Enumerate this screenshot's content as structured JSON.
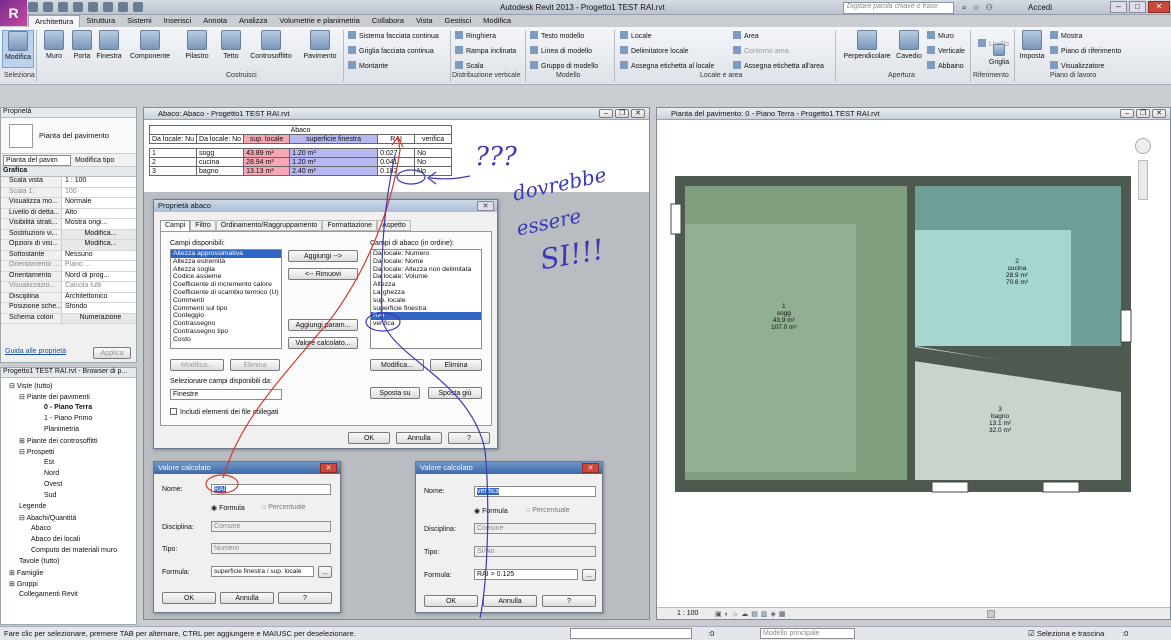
{
  "window": {
    "title": "Autodesk Revit 2013 -   Progetto1 TEST RAI.rvt",
    "search_placeholder": "Digitare parola chiave o frase",
    "signin": "Accedi"
  },
  "tabs": [
    "Architettura",
    "Struttura",
    "Sistemi",
    "Inserisci",
    "Annota",
    "Analizza",
    "Volumetrie e planimetria",
    "Collabora",
    "Vista",
    "Gestisci",
    "Modifica"
  ],
  "ribbon": {
    "big": [
      "Modifica",
      "Muro",
      "Porta",
      "Finestra",
      "Componente",
      "Pilastro",
      "Tetto",
      "Controsoffitto",
      "Pavimento",
      "Perpendicolare",
      "Cavedio",
      "Griglia",
      "Imposta"
    ],
    "small": [
      "Sistema facciata continua",
      "Griglia facciata continua",
      "Montante",
      "Ringhiera",
      "Rampa inclinata",
      "Scala",
      "Testo modello",
      "Linea di modello",
      "Gruppo di modello",
      "Locale",
      "Delimitatore  locale",
      "Assegna etichetta  al locale",
      "Area",
      "Contorno  area",
      "Assegna etichetta  all'area",
      "Muro",
      "Verticale",
      "Abbaino",
      "Livello",
      "Mostra",
      "Piano di riferimento",
      "Visualizzatore"
    ],
    "groups": [
      "Seleziona",
      "Costruisci",
      "Distribuzione verticale",
      "Modello",
      "Locale e area",
      "Apertura",
      "Riferimento",
      "Piano di lavoro"
    ]
  },
  "properties": {
    "title": "Proprietà",
    "type": "Pianta del pavimento",
    "selector": "Pianta del pavim",
    "edit_type": "Modifica tipo",
    "section": "Grafica",
    "rows": [
      [
        "Scala vista",
        "1 : 100"
      ],
      [
        "Scala 1:",
        "100"
      ],
      [
        "Visualizza mo...",
        "Normale"
      ],
      [
        "Livello di detta...",
        "Alto"
      ],
      [
        "Visibilità strati...",
        "Mostra origi..."
      ],
      [
        "Sostituzioni vi...",
        "Modifica..."
      ],
      [
        "Opzioni di visi...",
        "Modifica..."
      ],
      [
        "Sottostante",
        "Nessuno"
      ],
      [
        "Orientamento ...",
        "Piano ..."
      ],
      [
        "Orientamento",
        "Nord di prog..."
      ],
      [
        "Visualizzazio...",
        "Calcola tutti"
      ],
      [
        "Disciplina",
        "Architettonico"
      ],
      [
        "Posizione sche...",
        "Sfondo"
      ],
      [
        "Schema colori",
        "Numerazione"
      ]
    ],
    "help": "Guida alle proprietà",
    "apply": "Applica"
  },
  "browser": {
    "title": "Progetto1 TEST RAI.rvt - Browser di p...",
    "items": [
      "Viste (tutto)",
      "Piante dei pavimenti",
      "0 - Piano Terra",
      "1 - Piano Primo",
      "Planimetria",
      "Piante dei controsoffitti",
      "Prospetti",
      "Est",
      "Nord",
      "Ovest",
      "Sud",
      "Legende",
      "Abachi/Quantità",
      "Abaco",
      "Abaco dei locali",
      "Computo dei materiali muro",
      "Tavole (tutto)",
      "Famiglie",
      "Gruppi",
      "Collegamenti Revit"
    ]
  },
  "schedule": {
    "window_title": "Abaco: Abaco - Progetto1 TEST RAI.rvt",
    "caption": "Abaco",
    "headers": [
      "Da locale: Nu",
      "Da locale: No",
      "sup. locale",
      "superficie finestra",
      "RAI",
      "verifica"
    ],
    "rows": [
      [
        "1",
        "sogg",
        "43.89 m²",
        "1.20 m²",
        "0.027",
        "No"
      ],
      [
        "2",
        "cucina",
        "28.94 m²",
        "1.20 m²",
        "0.041",
        "No"
      ],
      [
        "3",
        "bagno",
        "13.13 m²",
        "2.40 m²",
        "0.183",
        "No"
      ]
    ]
  },
  "props_dialog": {
    "title": "Proprietà abaco",
    "tabs": [
      "Campi",
      "Filtro",
      "Ordinamento/Raggruppamento",
      "Formattazione",
      "Aspetto"
    ],
    "avail_label": "Campi disponibili:",
    "avail": [
      "Altezza approssimativa",
      "Altezza estremità",
      "Altezza soglia",
      "Codice assieme",
      "Coefficiente di incremento calore",
      "Coefficiente di scambio termico (U)",
      "Commenti",
      "Commenti sul tipo",
      "Conteggio",
      "Contrassegno",
      "Contrassegno tipo",
      "Costo"
    ],
    "sched_label": "Campi di abaco (in ordine):",
    "sched": [
      "Da locale: Numero",
      "Da locale: Nome",
      "Da locale: Altezza non delimitata",
      "Da locale: Volume",
      "Altezza",
      "Larghezza",
      "sup. locale",
      "superficie finestra",
      "RAI",
      "verifica"
    ],
    "add": "Aggiungi -->",
    "remove": "<-- Rimuovi",
    "add_param": "Aggiungi param...",
    "calc": "Valore calcolato...",
    "modify_l": "Modifica...",
    "delete_l": "Elimina",
    "modify_r": "Modifica...",
    "delete_r": "Elimina",
    "select_from": "Selezionare campi disponibili da:",
    "source": "Finestre",
    "include_links": "Includi elementi dei file collegati",
    "move_up": "Sposta su",
    "move_down": "Sposta giù",
    "ok": "OK",
    "cancel": "Annulla",
    "help": "?"
  },
  "calc1": {
    "title": "Valore calcolato",
    "name_label": "Nome:",
    "name": "RAI",
    "formula_opt": "Formula",
    "percent_opt": "Percentuale",
    "discipline_label": "Disciplina:",
    "discipline": "Comune",
    "type_label": "Tipo:",
    "type": "Numero",
    "formula_label": "Formula:",
    "formula": "superficie finestra / sup. locale",
    "browse": "...",
    "ok": "OK",
    "cancel": "Annulla",
    "help": "?"
  },
  "calc2": {
    "title": "Valore calcolato",
    "name_label": "Nome:",
    "name": "verifica",
    "formula_opt": "Formula",
    "percent_opt": "Percentuale",
    "discipline_label": "Disciplina:",
    "discipline": "Comune",
    "type_label": "Tipo:",
    "type": "Sì/No",
    "formula_label": "Formula:",
    "formula": "RAI > 0.125",
    "browse": "...",
    "ok": "OK",
    "cancel": "Annulla",
    "help": "?"
  },
  "plan": {
    "title": "Pianta del pavimento: 0 - Piano Terra - Progetto1 TEST RAI.rvt",
    "scale": "1 : 100",
    "rooms": [
      {
        "num": "1",
        "name": "sogg",
        "area": "43.9 m²",
        "vol": "107.0 m³"
      },
      {
        "num": "2",
        "name": "cucina",
        "area": "28.9 m²",
        "vol": "70.6 m³"
      },
      {
        "num": "3",
        "name": "bagno",
        "area": "13.1 m²",
        "vol": "32.0 m³"
      }
    ]
  },
  "annotation": {
    "q": "???",
    "l1": "dovrebbe",
    "l2": "essere",
    "l3": "SI!!!"
  },
  "status": {
    "hint": "Fare clic per selezionare, premere TAB per alternare, CTRL per aggiungere e MAIUSC per deselezionare.",
    "zero": ":0",
    "model": "Modello principale",
    "drag": "Seleziona e trascina",
    "filter": ":0"
  },
  "colors": {
    "pink": "#f6a7b4",
    "blue": "#b7b8f2",
    "ink": "#3a3ab5",
    "red": "#d23a2e"
  }
}
